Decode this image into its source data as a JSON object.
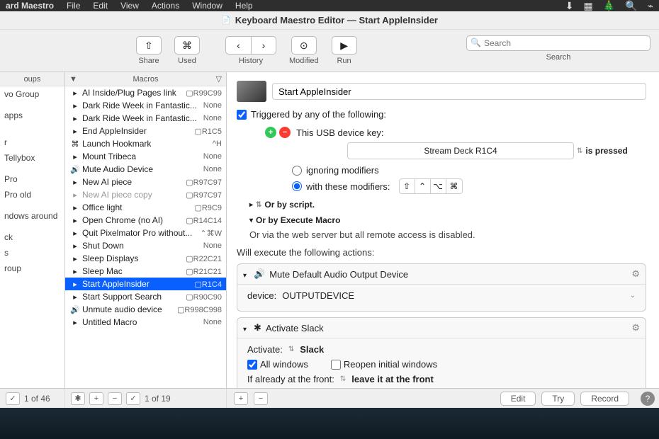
{
  "menubar": {
    "app": "ard Maestro",
    "items": [
      "File",
      "Edit",
      "View",
      "Actions",
      "Window",
      "Help"
    ]
  },
  "window": {
    "title": "Keyboard Maestro Editor — Start AppleInsider"
  },
  "toolbar": {
    "share": "Share",
    "used": "Used",
    "history": "History",
    "modified": "Modified",
    "run": "Run",
    "search_label": "Search",
    "search_placeholder": "Search"
  },
  "column_headers": {
    "groups": "oups",
    "macros": "Macros"
  },
  "groups": [
    "vo Group",
    "",
    "apps",
    "",
    "",
    "r",
    "Tellybox",
    "",
    "Pro",
    "Pro old",
    "",
    "ndows around",
    "",
    "ck",
    "s",
    "roup"
  ],
  "macros": [
    {
      "name": "AI Inside/Plug Pages link",
      "hk": "▢R99C99",
      "type": "app"
    },
    {
      "name": "Dark Ride Week in Fantastic...",
      "hk": "None",
      "type": "app"
    },
    {
      "name": "Dark Ride Week in Fantastic...",
      "hk": "None",
      "type": "app"
    },
    {
      "name": "End AppleInsider",
      "hk": "▢R1C5",
      "type": "app"
    },
    {
      "name": "Launch Hookmark",
      "hk": "^H",
      "type": "cmd"
    },
    {
      "name": "Mount Tribeca",
      "hk": "None",
      "type": "app"
    },
    {
      "name": "Mute Audio Device",
      "hk": "None",
      "type": "snd"
    },
    {
      "name": "New AI piece",
      "hk": "▢R97C97",
      "type": "app"
    },
    {
      "name": "New AI piece copy",
      "hk": "▢R97C97",
      "type": "app",
      "dim": true
    },
    {
      "name": "Office light",
      "hk": "▢R9C9",
      "type": "app"
    },
    {
      "name": "Open Chrome (no AI)",
      "hk": "▢R14C14",
      "type": "app"
    },
    {
      "name": "Quit Pixelmator Pro without...",
      "hk": "⌃⌘W",
      "type": "app"
    },
    {
      "name": "Shut Down",
      "hk": "None",
      "type": "app"
    },
    {
      "name": "Sleep Displays",
      "hk": "▢R22C21",
      "type": "app"
    },
    {
      "name": "Sleep Mac",
      "hk": "▢R21C21",
      "type": "app"
    },
    {
      "name": "Start AppleInsider",
      "hk": "▢R1C4",
      "type": "app",
      "sel": true
    },
    {
      "name": "Start Support Search",
      "hk": "▢R90C90",
      "type": "app"
    },
    {
      "name": "Unmute audio device",
      "hk": "▢R998C998",
      "type": "snd"
    },
    {
      "name": "Untitled Macro",
      "hk": "None",
      "type": "app"
    }
  ],
  "editor": {
    "macro_name": "Start AppleInsider",
    "triggered_by": "Triggered by any of the following:",
    "usb_device": "This USB device key:",
    "device_name": "Stream Deck R1C4",
    "is_pressed": "is pressed",
    "ignoring": "ignoring modifiers",
    "with_mods": "with these modifiers:",
    "or_script": "Or by script.",
    "or_execute": "Or by Execute Macro",
    "via_web": "Or via the web server but all remote access is disabled.",
    "will_execute": "Will execute the following actions:",
    "action1": {
      "title": "Mute Default Audio Output Device",
      "label": "device:",
      "value": "OUTPUTDEVICE"
    },
    "action2": {
      "title": "Activate Slack",
      "activate_label": "Activate:",
      "activate_value": "Slack",
      "all_windows": "All windows",
      "reopen": "Reopen initial windows",
      "front_label": "If already at the front:",
      "front_value": "leave it at the front"
    }
  },
  "statusbar": {
    "left_count": "1 of 46",
    "mid_count": "1 of 19",
    "edit": "Edit",
    "try": "Try",
    "record": "Record"
  }
}
